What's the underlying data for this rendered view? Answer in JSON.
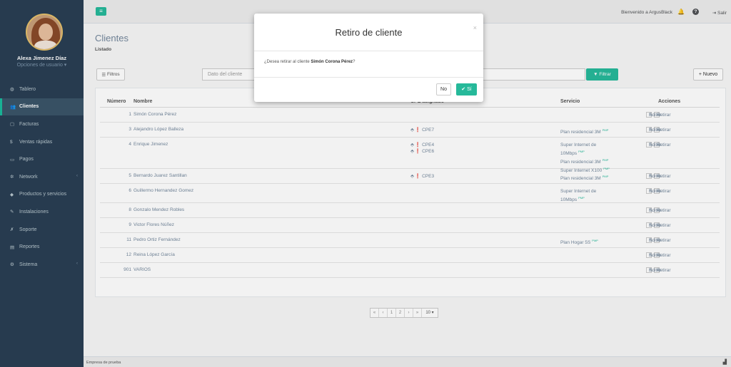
{
  "user": {
    "name": "Alexa Jimenez Díaz",
    "options": "Opciones de usuario ▾"
  },
  "nav": [
    {
      "name": "nav-tablero",
      "label": "Tablero",
      "icon": "dashboard-icon",
      "glyph": "◍",
      "chev": false,
      "active": false
    },
    {
      "name": "nav-clientes",
      "label": "Clientes",
      "icon": "users-icon",
      "glyph": "👥",
      "chev": false,
      "active": true
    },
    {
      "name": "nav-facturas",
      "label": "Facturas",
      "icon": "document-icon",
      "glyph": "▢",
      "chev": false,
      "active": false
    },
    {
      "name": "nav-ventas",
      "label": "Ventas rápidas",
      "icon": "dollar-icon",
      "glyph": "$",
      "chev": false,
      "active": false
    },
    {
      "name": "nav-pagos",
      "label": "Pagos",
      "icon": "card-icon",
      "glyph": "▭",
      "chev": false,
      "active": false
    },
    {
      "name": "nav-network",
      "label": "Network",
      "icon": "network-icon",
      "glyph": "✲",
      "chev": true,
      "active": false
    },
    {
      "name": "nav-productos",
      "label": "Productos y servicios",
      "icon": "tag-icon",
      "glyph": "◆",
      "chev": false,
      "active": false
    },
    {
      "name": "nav-instalaciones",
      "label": "Instalaciones",
      "icon": "pencil-icon",
      "glyph": "✎",
      "chev": false,
      "active": false
    },
    {
      "name": "nav-soporte",
      "label": "Soporte",
      "icon": "wrench-icon",
      "glyph": "✗",
      "chev": false,
      "active": false
    },
    {
      "name": "nav-reportes",
      "label": "Reportes",
      "icon": "chart-icon",
      "glyph": "▤",
      "chev": false,
      "active": false
    },
    {
      "name": "nav-sistema",
      "label": "Sistema",
      "icon": "cogs-icon",
      "glyph": "⚙",
      "chev": true,
      "active": false
    }
  ],
  "topbar": {
    "welcome": "Bienvenido a ArgusBlack",
    "logout": "Salir"
  },
  "page": {
    "title": "Clientes",
    "subtitle": "Listado"
  },
  "toolbar": {
    "filtros": "Filtros",
    "search_placeholder": "Dato del cliente",
    "filtrar": "Filtrar",
    "nuevo": "+ Nuevo"
  },
  "table": {
    "headers": {
      "numero": "Número",
      "nombre": "Nombre",
      "cpe": "CPE asignado",
      "servicio": "Servicio",
      "acciones": "Acciones"
    },
    "edit_label": "Editar",
    "remove_label": "Retirar",
    "rows": [
      {
        "num": "1",
        "name": "Simón Corona Pérez",
        "cpes": [],
        "services": [],
        "actions": true
      },
      {
        "num": "3",
        "name": "Alejandro López Balleza",
        "cpes": [
          "CPE7"
        ],
        "services": [
          "Plan residencial 3M"
        ],
        "actions": true
      },
      {
        "num": "4",
        "name": "Enrique Jimenez",
        "cpes": [
          "CPE4",
          "CPE6"
        ],
        "services": [
          "Super Internet de 10Mbps",
          "Plan residencial 3M",
          "Super Internet X100"
        ],
        "actions": true
      },
      {
        "num": "5",
        "name": "Bernardo Juarez Santillan",
        "cpes": [
          "CPE3"
        ],
        "services": [
          "Plan residencial 3M"
        ],
        "actions": true
      },
      {
        "num": "6",
        "name": "Guillermo Hernandez Gomez",
        "cpes": [],
        "services": [
          "Super Internet de 10Mbps"
        ],
        "actions": true
      },
      {
        "num": "8",
        "name": "Gonzalo Mendez Robles",
        "cpes": [],
        "services": [],
        "actions": true
      },
      {
        "num": "9",
        "name": "Victor Flores Núñez",
        "cpes": [],
        "services": [],
        "actions": true
      },
      {
        "num": "11",
        "name": "Pedro Ortiz Fernández",
        "cpes": [],
        "services": [
          "Plan Hogar 5S"
        ],
        "actions": true
      },
      {
        "num": "12",
        "name": "Reina López García",
        "cpes": [],
        "services": [],
        "actions": true
      },
      {
        "num": "901",
        "name": "VARIOS",
        "cpes": [],
        "services": [],
        "actions": true
      }
    ]
  },
  "service_tag": "PMP",
  "pagination": {
    "items": [
      "«",
      "‹",
      "1",
      "2",
      "›",
      "»"
    ],
    "page_size": "10 ▾"
  },
  "footer": {
    "text": "Empresa de prueba"
  },
  "modal": {
    "title": "Retiro de cliente",
    "close": "×",
    "question_prefix": "¿Desea retirar al cliente",
    "client_name": "Simón Corona Pérez",
    "question_suffix": "?",
    "no": "No",
    "yes": "Sí"
  }
}
